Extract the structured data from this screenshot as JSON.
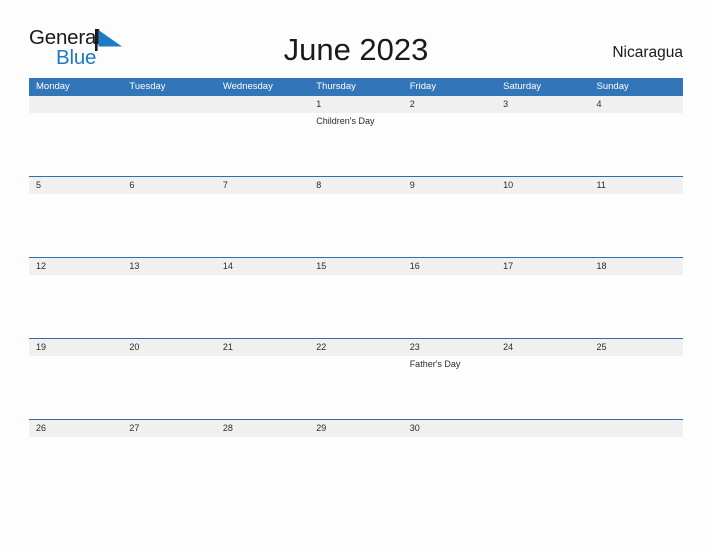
{
  "brand": {
    "name_part1": "General",
    "name_part2": "Blue",
    "flag_icon": "blue-triangle-flag-icon",
    "color_dark": "#1a1a1a",
    "color_blue": "#1f7ac4"
  },
  "header": {
    "title": "June 2023",
    "country": "Nicaragua"
  },
  "colors": {
    "header_band": "#3275b8",
    "date_strip": "#f0f0f0",
    "row_divider": "#2f6fae",
    "page_background": "#fdfdfd",
    "text": "#2b2b2b"
  },
  "calendar": {
    "weekdays": [
      "Monday",
      "Tuesday",
      "Wednesday",
      "Thursday",
      "Friday",
      "Saturday",
      "Sunday"
    ],
    "weeks": [
      {
        "days": [
          {
            "num": "",
            "events": []
          },
          {
            "num": "",
            "events": []
          },
          {
            "num": "",
            "events": []
          },
          {
            "num": "1",
            "events": [
              "Children's Day"
            ]
          },
          {
            "num": "2",
            "events": []
          },
          {
            "num": "3",
            "events": []
          },
          {
            "num": "4",
            "events": []
          }
        ]
      },
      {
        "days": [
          {
            "num": "5",
            "events": []
          },
          {
            "num": "6",
            "events": []
          },
          {
            "num": "7",
            "events": []
          },
          {
            "num": "8",
            "events": []
          },
          {
            "num": "9",
            "events": []
          },
          {
            "num": "10",
            "events": []
          },
          {
            "num": "11",
            "events": []
          }
        ]
      },
      {
        "days": [
          {
            "num": "12",
            "events": []
          },
          {
            "num": "13",
            "events": []
          },
          {
            "num": "14",
            "events": []
          },
          {
            "num": "15",
            "events": []
          },
          {
            "num": "16",
            "events": []
          },
          {
            "num": "17",
            "events": []
          },
          {
            "num": "18",
            "events": []
          }
        ]
      },
      {
        "days": [
          {
            "num": "19",
            "events": []
          },
          {
            "num": "20",
            "events": []
          },
          {
            "num": "21",
            "events": []
          },
          {
            "num": "22",
            "events": []
          },
          {
            "num": "23",
            "events": [
              "Father's Day"
            ]
          },
          {
            "num": "24",
            "events": []
          },
          {
            "num": "25",
            "events": []
          }
        ]
      },
      {
        "days": [
          {
            "num": "26",
            "events": []
          },
          {
            "num": "27",
            "events": []
          },
          {
            "num": "28",
            "events": []
          },
          {
            "num": "29",
            "events": []
          },
          {
            "num": "30",
            "events": []
          },
          {
            "num": "",
            "events": []
          },
          {
            "num": "",
            "events": []
          }
        ]
      }
    ]
  }
}
